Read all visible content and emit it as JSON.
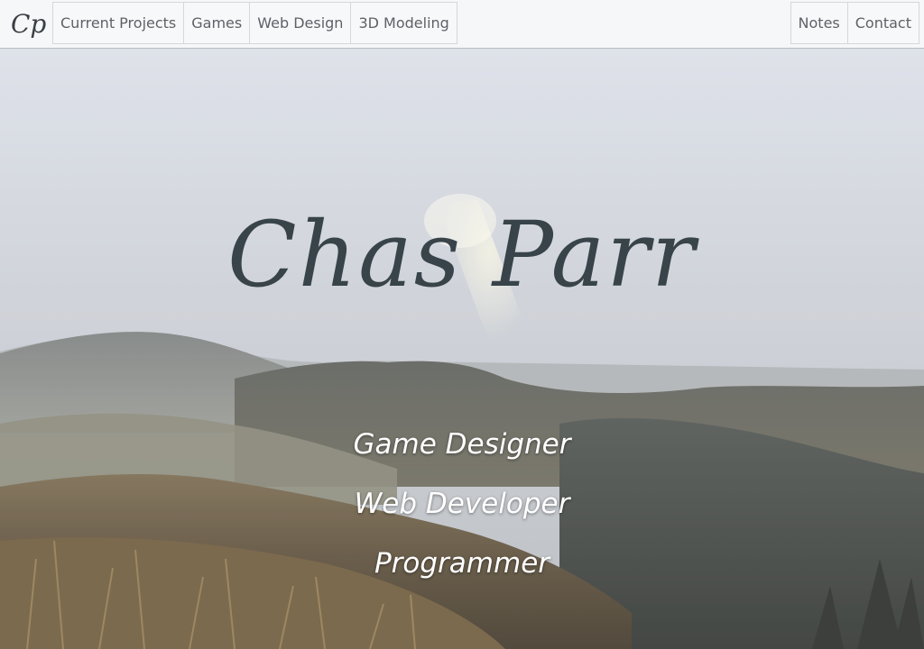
{
  "navbar": {
    "brand_mark": "Cp",
    "left_items": [
      {
        "label": "Current Projects"
      },
      {
        "label": "Games"
      },
      {
        "label": "Web Design"
      },
      {
        "label": "3D Modeling"
      }
    ],
    "right_items": [
      {
        "label": "Notes"
      },
      {
        "label": "Contact"
      }
    ]
  },
  "hero": {
    "title": "Chas Parr",
    "roles": [
      "Game Designer",
      "Web Developer",
      "Programmer"
    ],
    "background": "foggy-mountain-landscape"
  },
  "colors": {
    "navbar_bg": "#f6f7f9",
    "nav_text": "#5e6166",
    "title_text": "#38444a",
    "role_text": "#ffffff"
  }
}
